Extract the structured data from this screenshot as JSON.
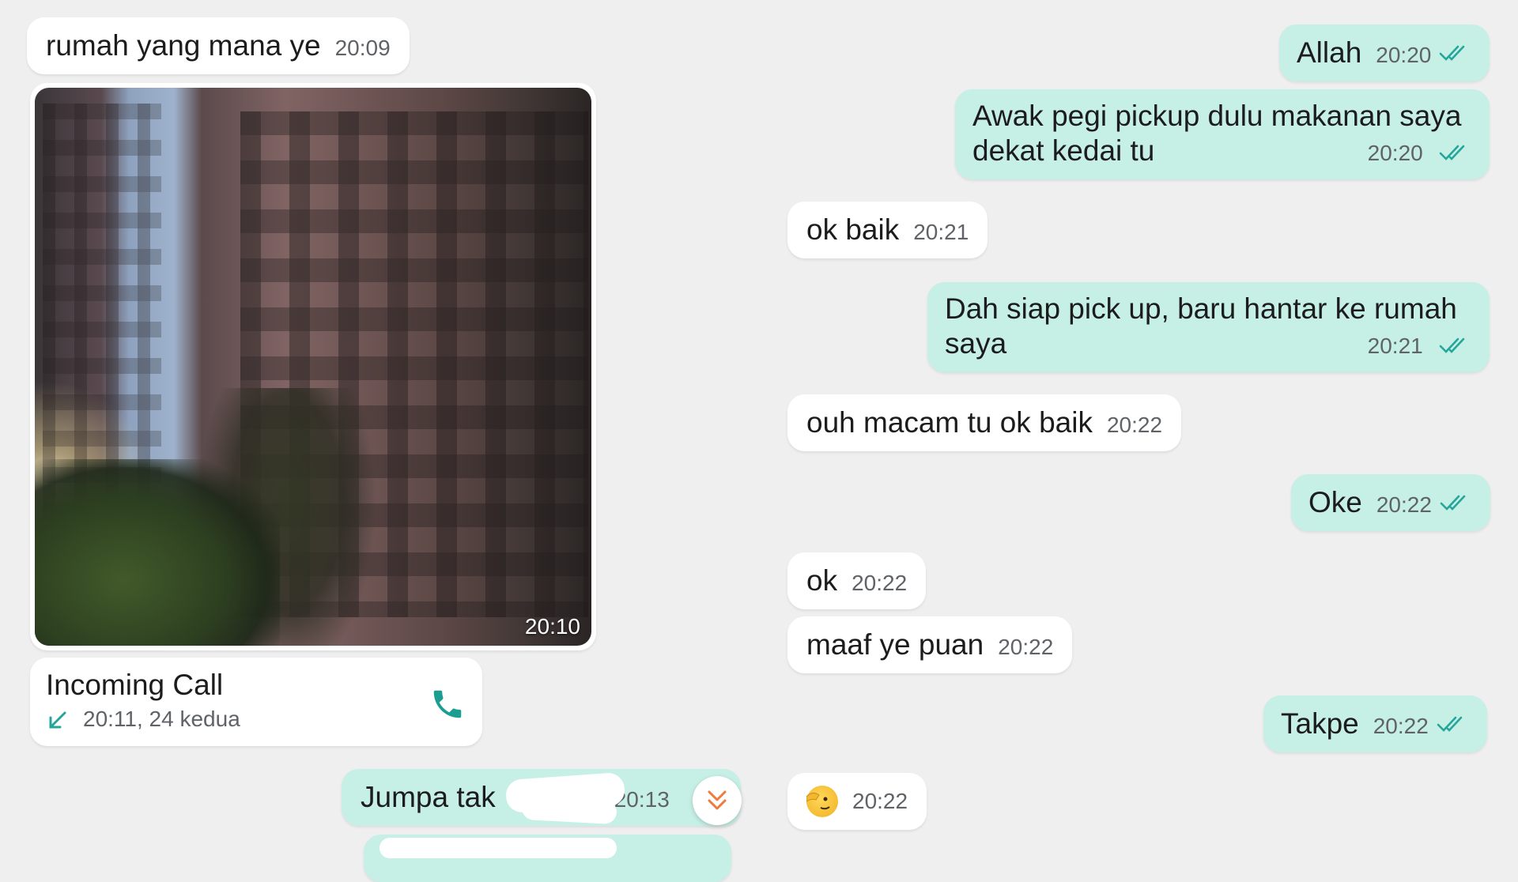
{
  "colors": {
    "chat_background": "#efefef",
    "incoming_bubble": "#ffffff",
    "outgoing_bubble": "#c6efe6",
    "read_ticks": "#26a69a",
    "call_icon": "#1a9e8f",
    "scroll_chevrons": "#f07a3a"
  },
  "left_messages": [
    {
      "text": "rumah yang mana ye",
      "time": "20:09"
    }
  ],
  "photo_message": {
    "time": "20:10"
  },
  "call_card": {
    "title": "Incoming Call",
    "subtitle": "20:11, 24 kedua",
    "icon": "phone-icon",
    "direction_icon": "incoming-arrow-icon"
  },
  "outgoing_partial": {
    "text": "Jumpa tak",
    "time": "20:13"
  },
  "messages": [
    {
      "side": "out",
      "text": "Allah",
      "time": "20:20",
      "status": "read"
    },
    {
      "side": "out",
      "text": "Awak pegi pickup dulu makanan saya dekat kedai tu",
      "line1": "Awak pegi pickup dulu makanan saya",
      "line2": "dekat kedai tu",
      "time": "20:20",
      "status": "read"
    },
    {
      "side": "in",
      "text": "ok baik",
      "time": "20:21"
    },
    {
      "side": "out",
      "text": "Dah siap pick up, baru hantar ke rumah saya",
      "line1": "Dah siap pick up, baru hantar ke rumah",
      "line2": "saya",
      "time": "20:21",
      "status": "read"
    },
    {
      "side": "in",
      "text": "ouh macam tu ok baik",
      "time": "20:22"
    },
    {
      "side": "out",
      "text": "Oke",
      "time": "20:22",
      "status": "read"
    },
    {
      "side": "in",
      "text": "ok",
      "time": "20:22"
    },
    {
      "side": "in",
      "text": "maaf ye puan",
      "time": "20:22"
    },
    {
      "side": "out",
      "text": "Takpe",
      "time": "20:22",
      "status": "read"
    },
    {
      "side": "in",
      "emoji": "saluting-face-emoji",
      "time": "20:22"
    }
  ],
  "scroll_button": {
    "icon": "double-chevron-down-icon"
  }
}
